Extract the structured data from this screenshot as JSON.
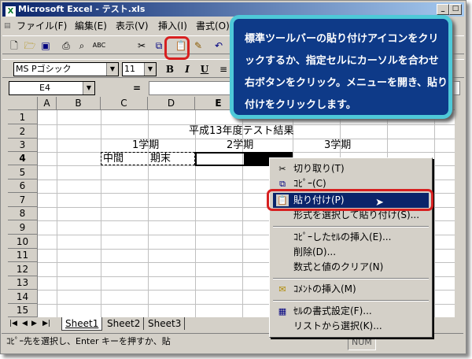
{
  "window": {
    "title": "Microsoft Excel - テスト.xls",
    "app_icon": "excel-icon"
  },
  "menubar": {
    "items": [
      "ファイル(F)",
      "編集(E)",
      "表示(V)",
      "挿入(I)",
      "書式(O)"
    ]
  },
  "formatting": {
    "font_name": "MS Pゴシック",
    "font_size": "11",
    "bold": "B",
    "italic": "I",
    "underline": "U"
  },
  "formula_bar": {
    "name_box": "E4",
    "equals": "="
  },
  "grid": {
    "columns": [
      "A",
      "B",
      "C",
      "D",
      "E"
    ],
    "rows": [
      "1",
      "2",
      "3",
      "4",
      "5",
      "6",
      "7",
      "8",
      "9",
      "10",
      "11",
      "12",
      "13",
      "14",
      "15"
    ],
    "title_cell": "平成13年度テスト結果",
    "term1": "1学期",
    "term2": "2学期",
    "term3": "3学期",
    "midterm": "中間",
    "final": "期末"
  },
  "sheet_tabs": [
    "Sheet1",
    "Sheet2",
    "Sheet3"
  ],
  "status_bar": {
    "text": "ｺﾋﾟｰ先を選択し、Enter キーを押すか、貼",
    "num": "NUM"
  },
  "context_menu": {
    "items": [
      {
        "label": "切り取り(T)",
        "icon": "scissors-icon"
      },
      {
        "label": "ｺﾋﾟｰ(C)",
        "icon": "copy-icon"
      },
      {
        "label": "貼り付け(P)",
        "icon": "paste-icon",
        "highlighted": true
      },
      {
        "label": "形式を選択して貼り付け(S)..."
      },
      {
        "label": "ｺﾋﾟｰしたｾﾙの挿入(E)..."
      },
      {
        "label": "削除(D)..."
      },
      {
        "label": "数式と値のクリア(N)"
      },
      {
        "label": "ｺﾒﾝﾄの挿入(M)",
        "icon": "comment-icon"
      },
      {
        "label": "ｾﾙの書式設定(F)...",
        "icon": "format-icon"
      },
      {
        "label": "リストから選択(K)..."
      }
    ]
  },
  "callout": {
    "text": "標準ツールバーの貼り付けアイコンをクリックするか、指定セルにカーソルを合わせ右ボタンをクリック。メニューを開き、貼り付けをクリックします。"
  },
  "colors": {
    "title_bar": "#0a246a",
    "menu_highlight": "#0a246a",
    "callout_bg": "#0e3a88",
    "callout_border": "#4ec9d8",
    "ring": "#d72020"
  }
}
